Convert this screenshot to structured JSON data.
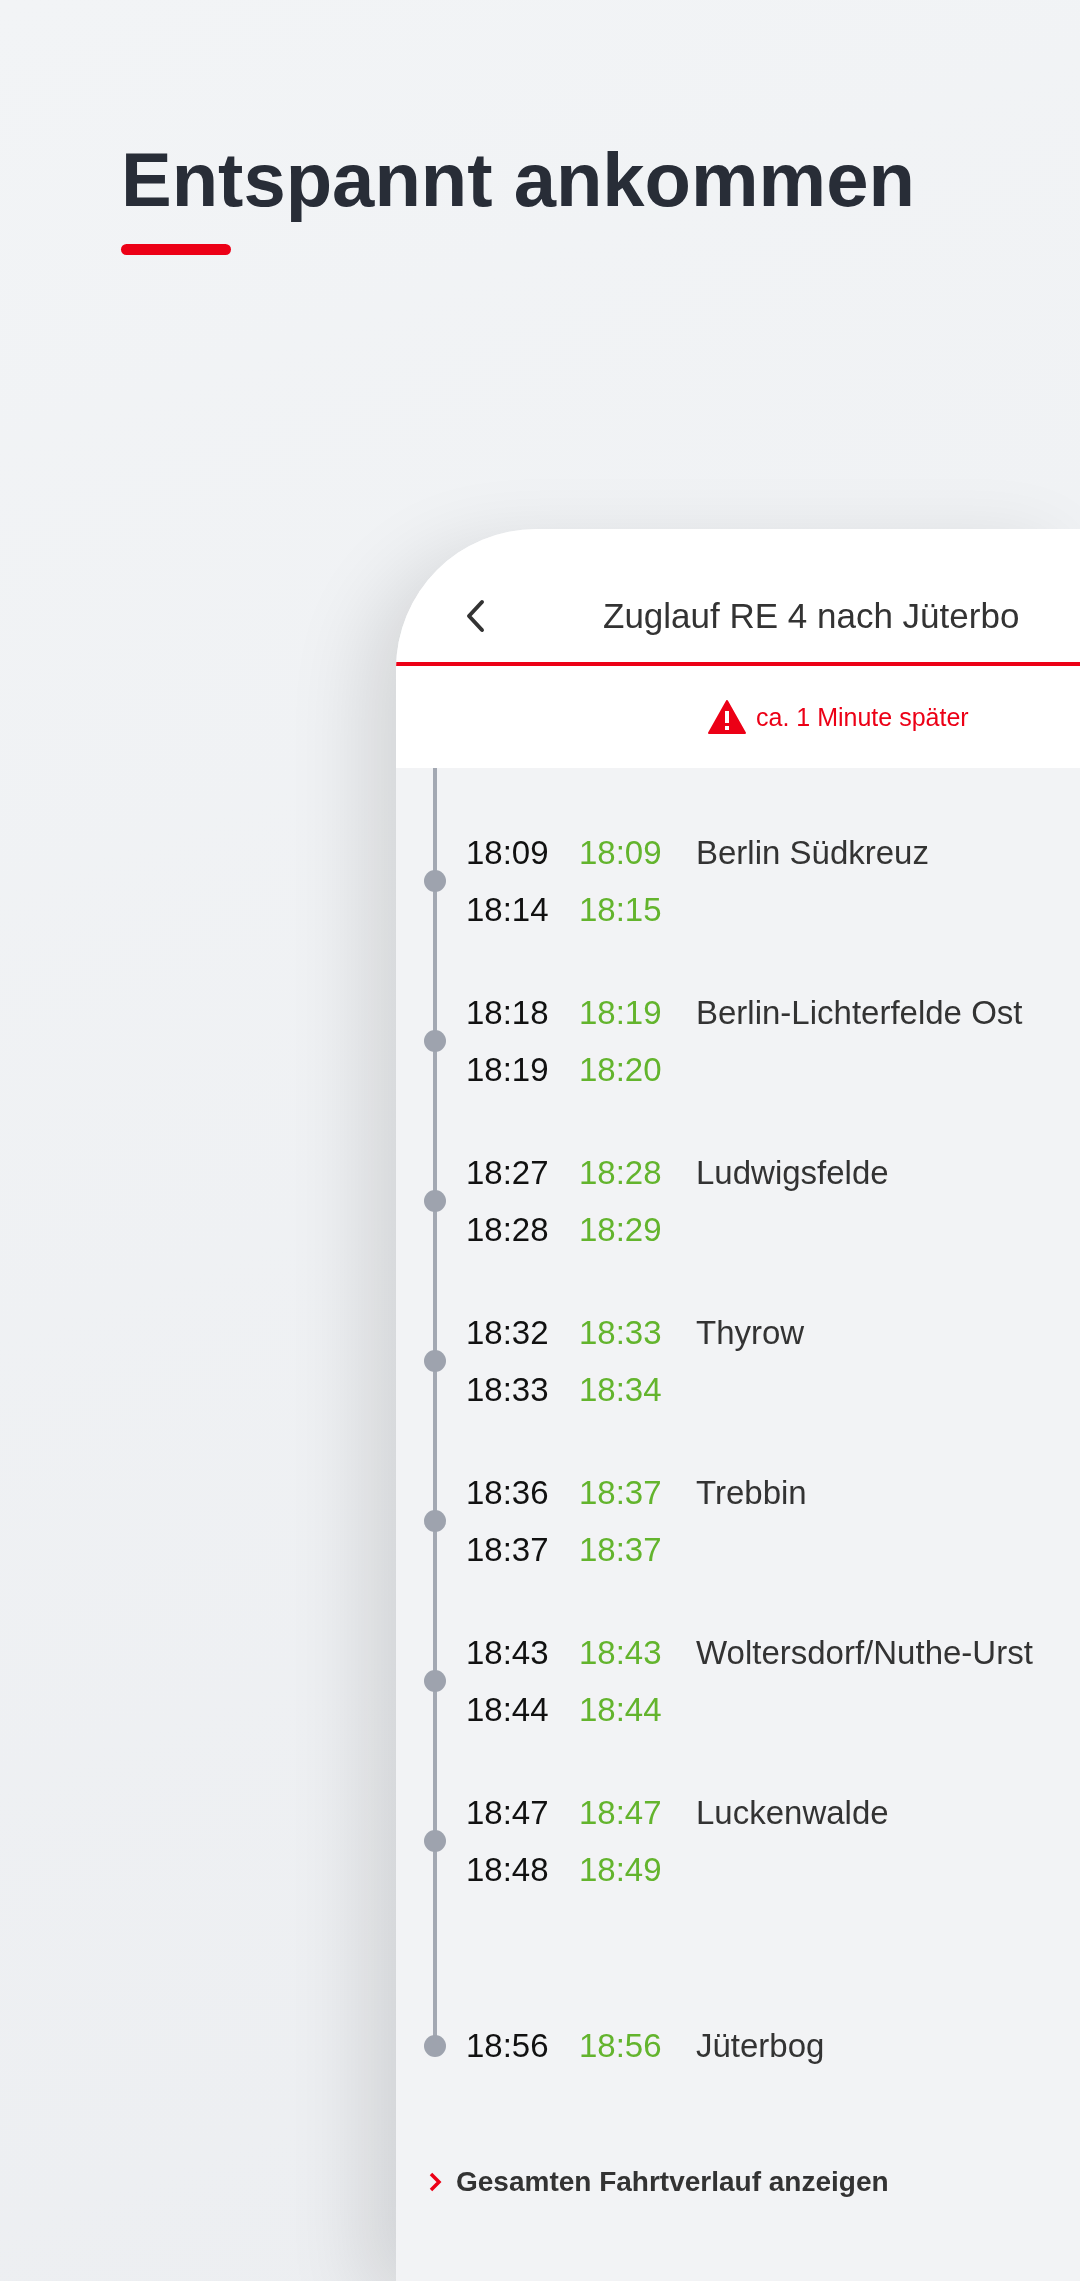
{
  "headline": "Entspannt ankommen",
  "header": {
    "title": "Zuglauf RE 4 nach Jüterbo"
  },
  "notice": "ca. 1 Minute später",
  "stops": [
    {
      "name": "Berlin Südkreuz",
      "arrival": {
        "planned": "18:09",
        "actual": "18:09"
      },
      "departure": {
        "planned": "18:14",
        "actual": "18:15"
      }
    },
    {
      "name": "Berlin-Lichterfelde Ost",
      "arrival": {
        "planned": "18:18",
        "actual": "18:19"
      },
      "departure": {
        "planned": "18:19",
        "actual": "18:20"
      }
    },
    {
      "name": "Ludwigsfelde",
      "arrival": {
        "planned": "18:27",
        "actual": "18:28"
      },
      "departure": {
        "planned": "18:28",
        "actual": "18:29"
      }
    },
    {
      "name": "Thyrow",
      "arrival": {
        "planned": "18:32",
        "actual": "18:33"
      },
      "departure": {
        "planned": "18:33",
        "actual": "18:34"
      }
    },
    {
      "name": "Trebbin",
      "arrival": {
        "planned": "18:36",
        "actual": "18:37"
      },
      "departure": {
        "planned": "18:37",
        "actual": "18:37"
      }
    },
    {
      "name": "Woltersdorf/Nuthe-Urst",
      "arrival": {
        "planned": "18:43",
        "actual": "18:43"
      },
      "departure": {
        "planned": "18:44",
        "actual": "18:44"
      }
    },
    {
      "name": "Luckenwalde",
      "arrival": {
        "planned": "18:47",
        "actual": "18:47"
      },
      "departure": {
        "planned": "18:48",
        "actual": "18:49"
      }
    },
    {
      "name": "Jüterbog",
      "arrival": {
        "planned": "18:56",
        "actual": "18:56"
      }
    }
  ],
  "footer_link": "Gesamten Fahrtverlauf anzeigen"
}
